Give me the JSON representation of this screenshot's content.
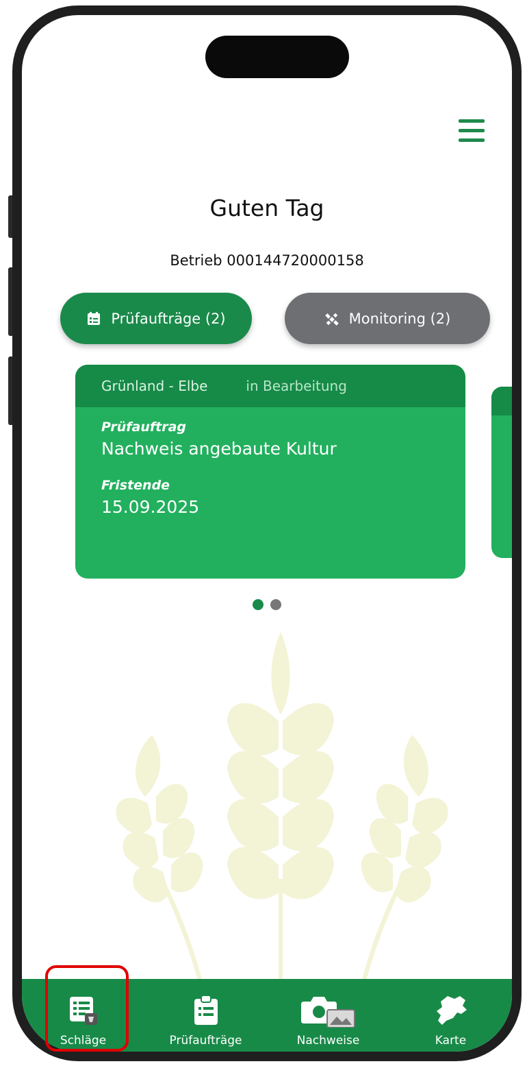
{
  "header": {
    "greeting": "Guten Tag",
    "betrieb": "Betrieb 000144720000158"
  },
  "filters": {
    "pruefauftraege_label": "Prüfaufträge (2)",
    "monitoring_label": "Monitoring (2)"
  },
  "card": {
    "field": "Grünland - Elbe",
    "status": "in Bearbeitung",
    "type_label": "Prüfauftrag",
    "type_value": "Nachweis angebaute Kultur",
    "deadline_label": "Fristende",
    "deadline_value": "15.09.2025"
  },
  "carousel": {
    "pages": 2,
    "active_index": 0
  },
  "bottom_nav": {
    "items": [
      {
        "label": "Schläge",
        "icon": "field-list-icon"
      },
      {
        "label": "Prüfaufträge",
        "icon": "clipboard-icon"
      },
      {
        "label": "Nachweise",
        "icon": "camera-gallery-icon"
      },
      {
        "label": "Karte",
        "icon": "map-region-icon"
      }
    ],
    "highlighted_index": 0
  },
  "colors": {
    "primary_green": "#1a8a4a",
    "card_green": "#22b05e",
    "card_header_green": "#168a47",
    "grey_pill": "#6d6f72",
    "wheat": "#f3f3d6",
    "highlight_red": "#e00000"
  }
}
